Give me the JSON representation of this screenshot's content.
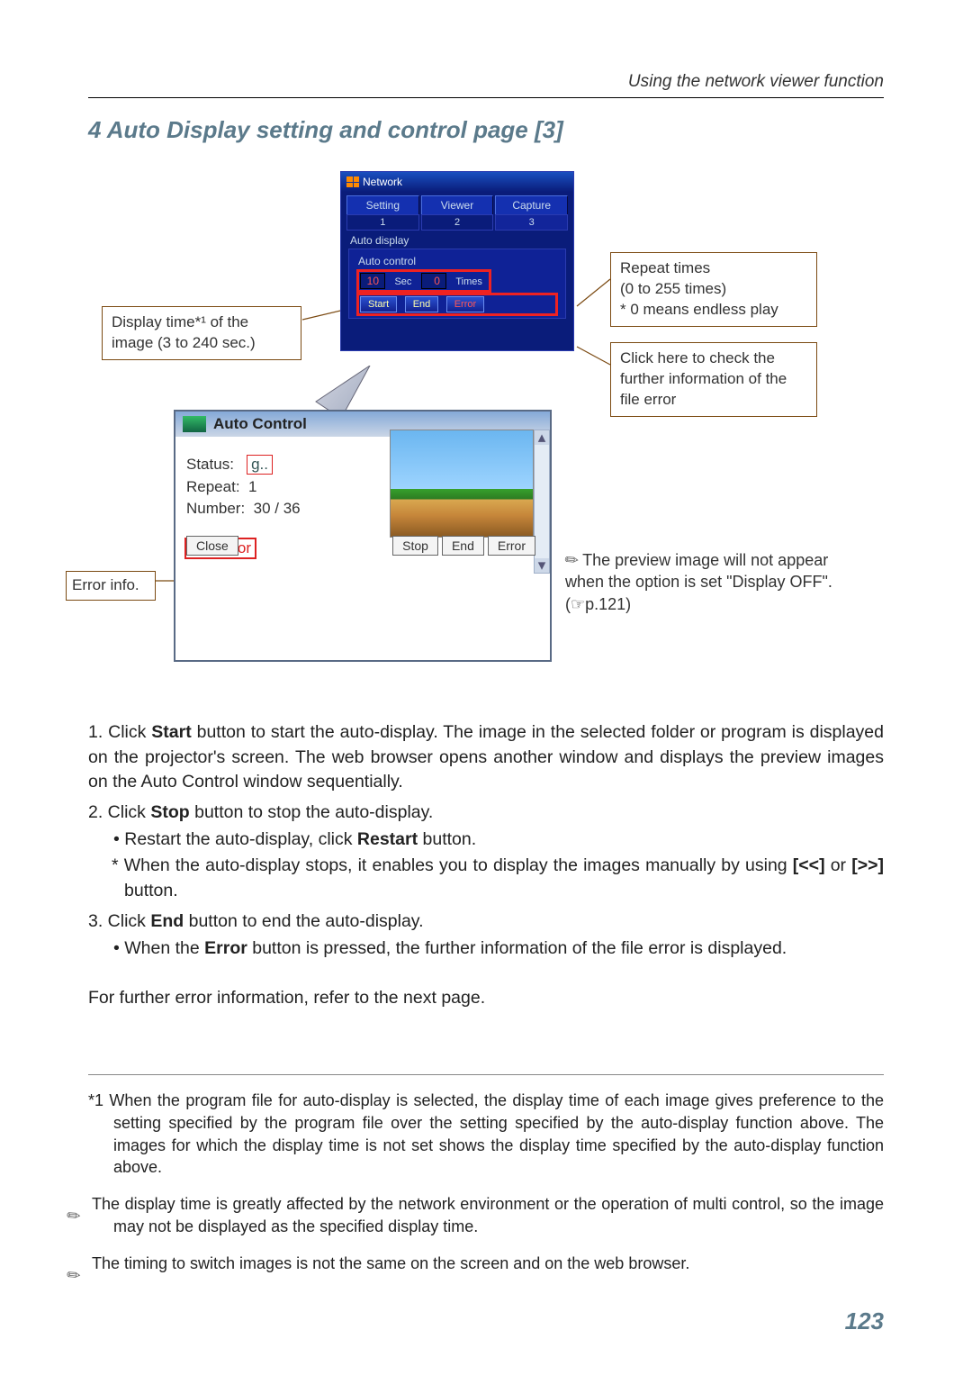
{
  "header": {
    "breadcrumb": "Using the network viewer function"
  },
  "title": "4 Auto Display setting and control page [3]",
  "net": {
    "title": "Network",
    "tabs": {
      "setting": "Setting",
      "viewer": "Viewer",
      "capture": "Capture"
    },
    "subtabs": [
      "1",
      "2",
      "3"
    ],
    "section_auto_display": "Auto display",
    "section_auto_control": "Auto control",
    "time_value": "10",
    "sec_label": "Sec",
    "repeat_value": "0",
    "times_label": "Times",
    "btn_start": "Start",
    "btn_end": "End",
    "btn_error": "Error"
  },
  "callouts": {
    "repeat": "Repeat times\n(0 to 255 times)\n* 0 means endless play",
    "display_time": "Display time*¹ of the image (3 to 240 sec.)",
    "error_click": "Click here to check the further information of the file error",
    "error_info_label": "Error info."
  },
  "ac": {
    "title": "Auto Control",
    "status_label": "Status:",
    "status_value": "g..",
    "repeat_label": "Repeat:",
    "repeat_value": "1",
    "number_label": "Number:",
    "number_value": "30 / 36",
    "file_error": "File error",
    "btn_close": "Close",
    "btn_stop": "Stop",
    "btn_end": "End",
    "btn_error": "Error"
  },
  "preview_note": "The preview image will not appear when the option is set \"Display OFF\".(☞p.121)",
  "body": {
    "i1a": "1. Click ",
    "i1b": "Start",
    "i1c": " button to start the auto-display. The image in the selected folder or program is displayed on the projector's screen. The web browser opens another window and displays the preview images on the Auto Control window sequentially.",
    "i2a": "2. Click ",
    "i2b": "Stop",
    "i2c": " button to stop the auto-display.",
    "i2_b1a": "• Restart the auto-display, click ",
    "i2_b1b": "Restart",
    "i2_b1c": " button.",
    "i2_s1a": "* When the auto-display stops, it enables you to display the images manually by using ",
    "i2_s1b": "[<<]",
    "i2_s1c": " or ",
    "i2_s1d": "[>>]",
    "i2_s1e": " button.",
    "i3a": "3. Click ",
    "i3b": "End",
    "i3c": " button to end the auto-display.",
    "i3_b1a": "• When the ",
    "i3_b1b": "Error",
    "i3_b1c": " button is pressed, the further information of the file error is displayed.",
    "final": "For further error information, refer to the next page."
  },
  "footnotes": {
    "f1": "*1 When the program file for auto-display is selected, the display time of each image gives preference to the setting specified by the program file over the setting specified by the auto-display function above. The images for which the display time is not set shows the display time specified by the auto-display function above.",
    "f2": "The display time is greatly affected by the network environment or the operation of multi control, so the image may not be displayed as the specified display time.",
    "f3": "The timing to switch images is not the same on the screen and on the web browser."
  },
  "page_number": "123"
}
